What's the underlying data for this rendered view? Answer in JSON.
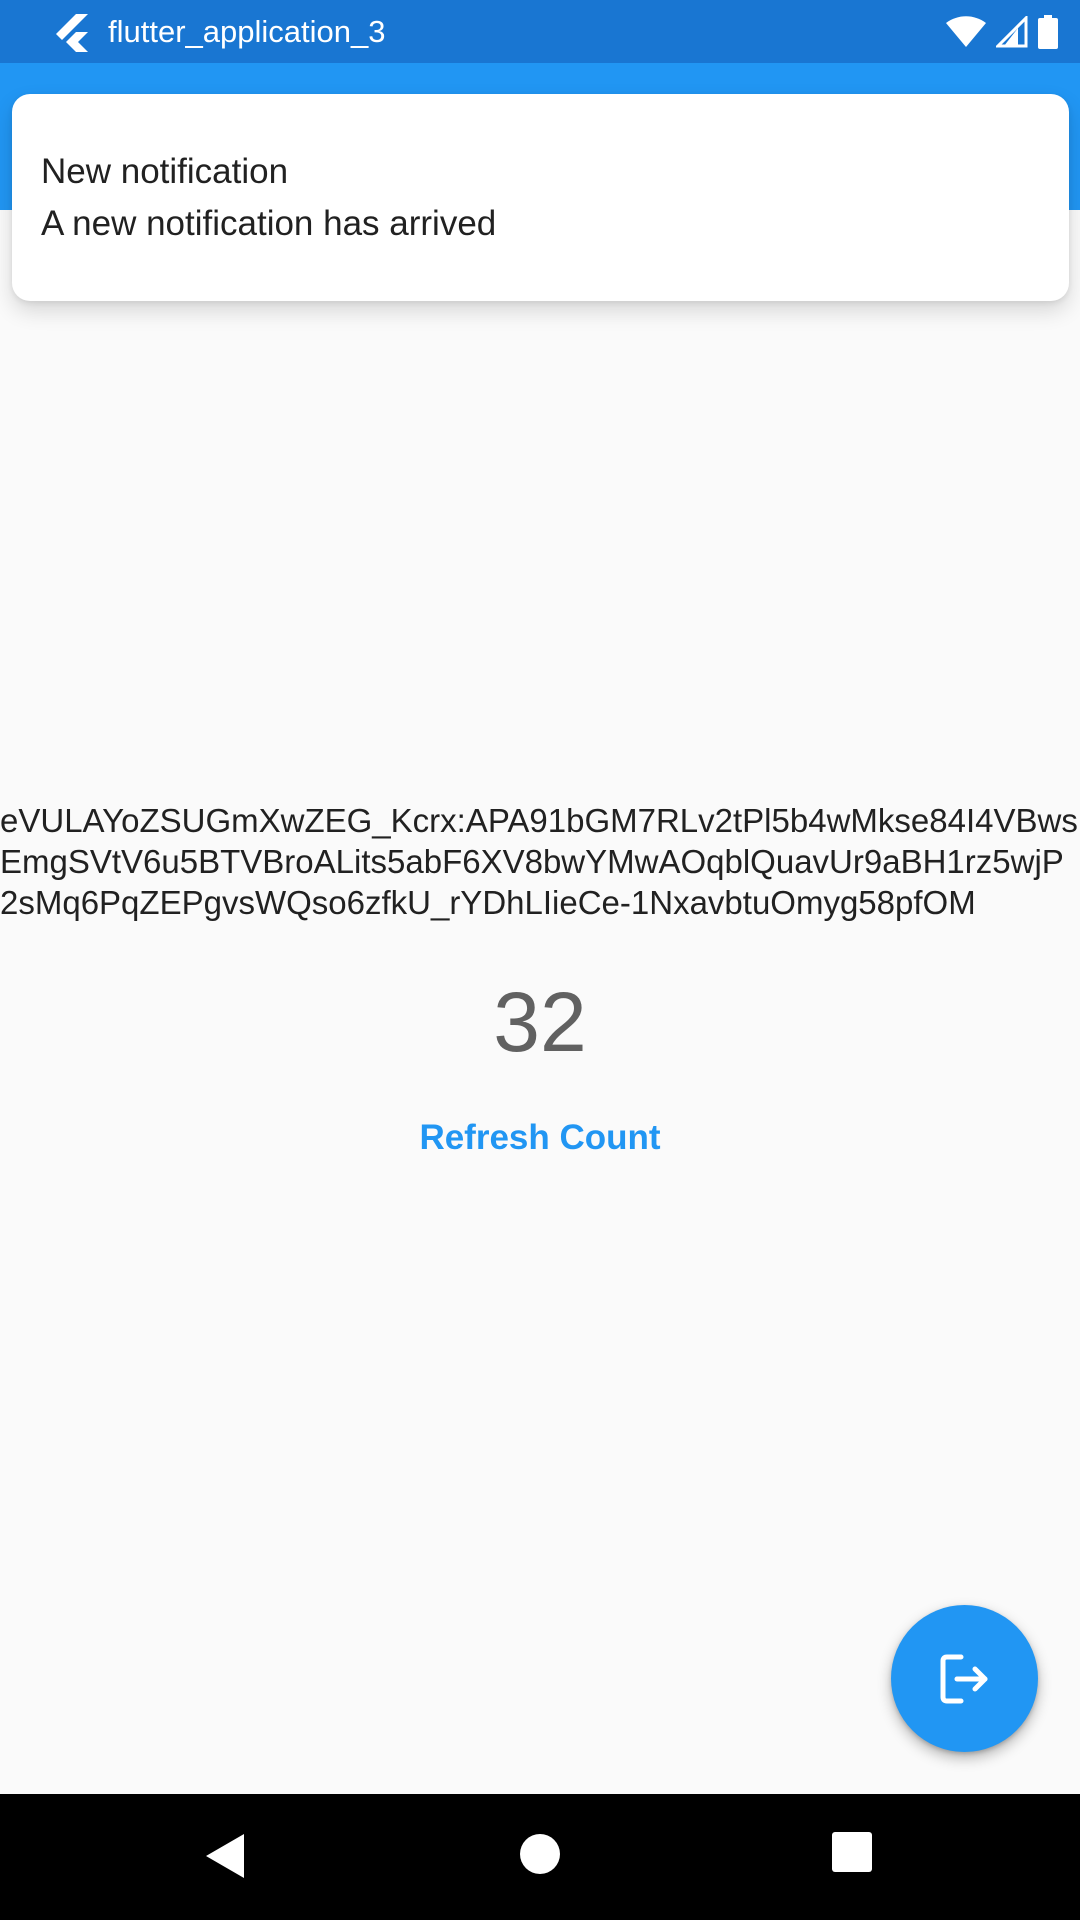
{
  "status_bar": {
    "app_title": "flutter_application_3",
    "icons": [
      "flutter-logo-icon",
      "wifi-icon",
      "cell-signal-icon",
      "battery-icon"
    ]
  },
  "notification": {
    "title": "New notification",
    "body": "A new notification has arrived"
  },
  "main": {
    "token": "eVULAYoZSUGmXwZEG_Kcrx:APA91bGM7RLv2tPl5b4wMkse84I4VBwsEmgSVtV6u5BTVBroALits5abF6XV8bwYMwAOqblQuavUr9aBH1rz5wjP2sMq6PqZEPgvsWQso6zfkU_rYDhLIieCe-1NxavbtuOmyg58pfOM",
    "count": "32",
    "refresh_label": "Refresh Count"
  },
  "fab": {
    "icon": "logout-icon"
  },
  "nav_bar": {
    "icons": [
      "back-icon",
      "home-icon",
      "recents-icon"
    ]
  },
  "colors": {
    "status_bar": "#1976d2",
    "app_bar": "#2196f3",
    "accent": "#2196f3",
    "background": "#fafafa",
    "nav_bar": "#000000"
  }
}
